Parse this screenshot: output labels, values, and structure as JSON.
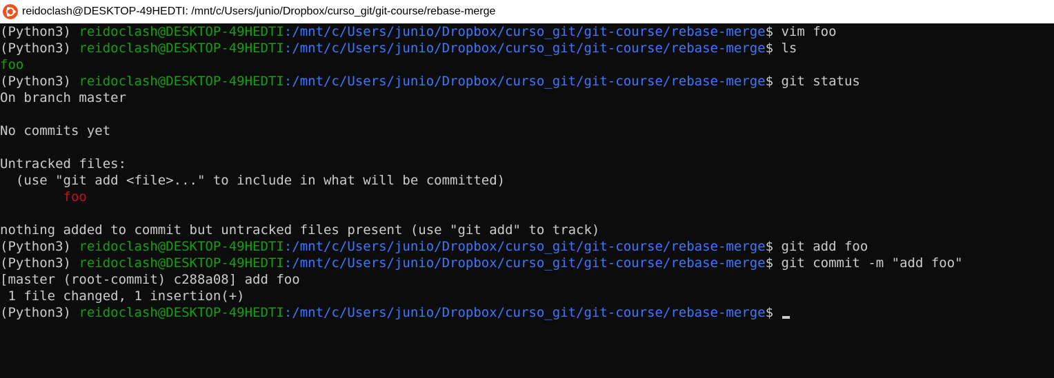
{
  "window": {
    "title": "reidoclash@DESKTOP-49HEDTI: /mnt/c/Users/junio/Dropbox/curso_git/git-course/rebase-merge",
    "icon": "ubuntu-icon"
  },
  "colors": {
    "background": "#0c0c0c",
    "text": "#cccccc",
    "user_host": "#13a10e",
    "path": "#3b78ff",
    "untracked_file": "#c50f1f"
  },
  "prompt": {
    "venv": "(Python3) ",
    "user_host": "reidoclash@DESKTOP-49HEDTI",
    "path": ":/mnt/c/Users/junio/Dropbox/curso_git/git-course/rebase-merge",
    "symbol": "$ "
  },
  "commands": {
    "c1": "vim foo",
    "c2": "ls",
    "c3": "git status",
    "c4": "git add foo",
    "c5": "git commit -m \"add foo\""
  },
  "output": {
    "ls_result": "foo",
    "on_branch": "On branch master",
    "no_commits": "No commits yet",
    "untracked_header": "Untracked files:",
    "untracked_hint": "  (use \"git add <file>...\" to include in what will be committed)",
    "untracked_indent": "        ",
    "untracked_file": "foo",
    "nothing_added": "nothing added to commit but untracked files present (use \"git add\" to track)",
    "commit_result": "[master (root-commit) c288a08] add foo",
    "commit_stats": " 1 file changed, 1 insertion(+)"
  }
}
